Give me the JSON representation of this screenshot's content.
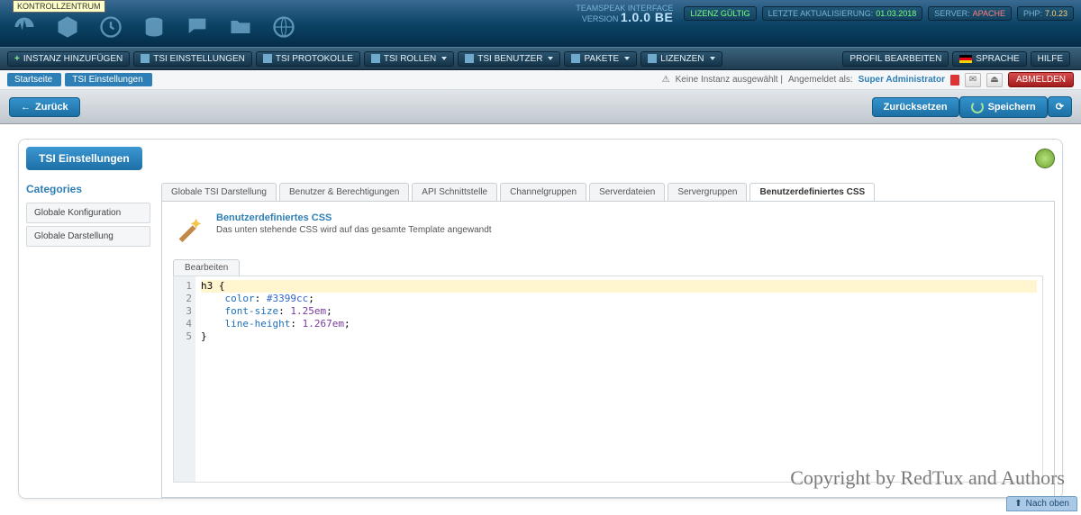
{
  "header": {
    "tooltip": "KONTROLLZENTRUM",
    "product": "TEAMSPEAK INTERFACE",
    "version_label": "VERSION",
    "version": "1.0.0 BE",
    "pills": {
      "license": "LIZENZ GÜLTIG",
      "update_label": "LETZTE AKTUALISIERUNG:",
      "update_val": "01.03.2018",
      "server_label": "SERVER:",
      "server_val": "APACHE",
      "php_label": "PHP:",
      "php_val": "7.0.23"
    }
  },
  "menu": {
    "add_instance": "INSTANZ HINZUFÜGEN",
    "tsi_settings": "TSI EINSTELLUNGEN",
    "tsi_logs": "TSI PROTOKOLLE",
    "tsi_roles": "TSI ROLLEN",
    "tsi_users": "TSI BENUTZER",
    "packages": "PAKETE",
    "licenses": "LIZENZEN",
    "profile_edit": "PROFIL BEARBEITEN",
    "language": "SPRACHE",
    "help": "HILFE"
  },
  "crumb": {
    "home": "Startseite",
    "current": "TSI Einstellungen",
    "warn_icon": "⚠",
    "warn": "Keine Instanz ausgewählt |",
    "login_as": "Angemeldet als:",
    "user": "Super Administrator",
    "logout": "ABMELDEN"
  },
  "actions": {
    "back": "Zurück",
    "reset": "Zurücksetzen",
    "save": "Speichern"
  },
  "panel": {
    "title": "TSI Einstellungen",
    "categories_title": "Categories",
    "categories": [
      "Globale Konfiguration",
      "Globale Darstellung"
    ]
  },
  "tabs": [
    "Globale TSI Darstellung",
    "Benutzer & Berechtigungen",
    "API Schnittstelle",
    "Channelgruppen",
    "Serverdateien",
    "Servergruppen",
    "Benutzerdefiniertes CSS"
  ],
  "active_tab": 6,
  "section": {
    "title": "Benutzerdefiniertes CSS",
    "desc": "Das unten stehende CSS wird auf das gesamte Template angewandt",
    "edit_tab": "Bearbeiten"
  },
  "code_lines": [
    "1",
    "2",
    "3",
    "4",
    "5"
  ],
  "css_code": {
    "l1": "h3 {",
    "l2_k": "    color",
    "l2_v": "#3399cc",
    "l3_k": "    font-size",
    "l3_v": "1.25em",
    "l4_k": "    line-height",
    "l4_v": "1.267em",
    "l5": "}"
  },
  "copyright": "Copyright by RedTux and Authors",
  "to_top": "Nach oben"
}
